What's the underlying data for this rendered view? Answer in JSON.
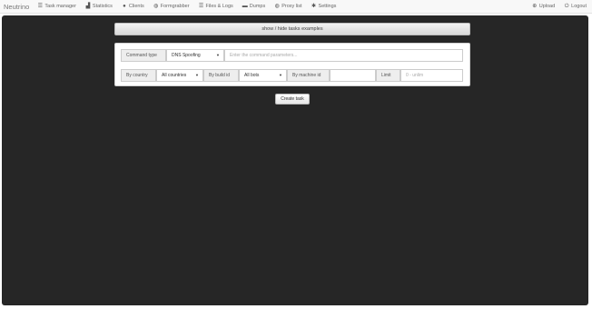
{
  "nav": {
    "brand": "Neutrino",
    "items": [
      {
        "label": "Task manager",
        "icon": "list-icon"
      },
      {
        "label": "Statistics",
        "icon": "chart-icon"
      },
      {
        "label": "Clients",
        "icon": "user-icon"
      },
      {
        "label": "Formgrabber",
        "icon": "globe-icon"
      },
      {
        "label": "Files & Logs",
        "icon": "list-icon"
      },
      {
        "label": "Dumps",
        "icon": "card-icon"
      },
      {
        "label": "Proxy list",
        "icon": "globe-icon"
      },
      {
        "label": "Settings",
        "icon": "gear-icon"
      }
    ],
    "right": [
      {
        "label": "Upload",
        "icon": "plus-circle-icon"
      },
      {
        "label": "Logout",
        "icon": "power-icon"
      }
    ]
  },
  "examples_toggle": "show / hide tasks examples",
  "form": {
    "command_type_label": "Command type",
    "command_type_value": "DNS Spoofing",
    "command_params_placeholder": "Enter the command parameters...",
    "by_country_label": "By country",
    "country_value": "All countries",
    "by_build_id_label": "By build id",
    "build_id_value": "All bots",
    "by_machine_id_label": "By machine id",
    "machine_id_value": "",
    "limit_label": "Limit",
    "limit_placeholder": "0 - unlim"
  },
  "create_button": "Create task"
}
